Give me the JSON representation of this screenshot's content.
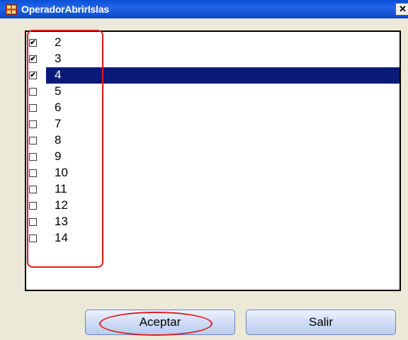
{
  "window": {
    "title": "OperadorAbrirIslas",
    "close_glyph": "✕"
  },
  "list": {
    "items": [
      {
        "label": "2",
        "checked": true,
        "selected": false
      },
      {
        "label": "3",
        "checked": true,
        "selected": false
      },
      {
        "label": "4",
        "checked": true,
        "selected": true
      },
      {
        "label": "5",
        "checked": false,
        "selected": false
      },
      {
        "label": "6",
        "checked": false,
        "selected": false
      },
      {
        "label": "7",
        "checked": false,
        "selected": false
      },
      {
        "label": "8",
        "checked": false,
        "selected": false
      },
      {
        "label": "9",
        "checked": false,
        "selected": false
      },
      {
        "label": "10",
        "checked": false,
        "selected": false
      },
      {
        "label": "11",
        "checked": false,
        "selected": false
      },
      {
        "label": "12",
        "checked": false,
        "selected": false
      },
      {
        "label": "13",
        "checked": false,
        "selected": false
      },
      {
        "label": "14",
        "checked": false,
        "selected": false
      }
    ]
  },
  "buttons": {
    "accept_label": "Aceptar",
    "exit_label": "Salir"
  },
  "colors": {
    "selection": "#0a1a7a",
    "annotation": "#e21a1a",
    "titlebar": "#0a4fd6"
  },
  "icons": {
    "app": "window-app-icon",
    "close": "close-icon",
    "check": "checkmark-icon"
  }
}
